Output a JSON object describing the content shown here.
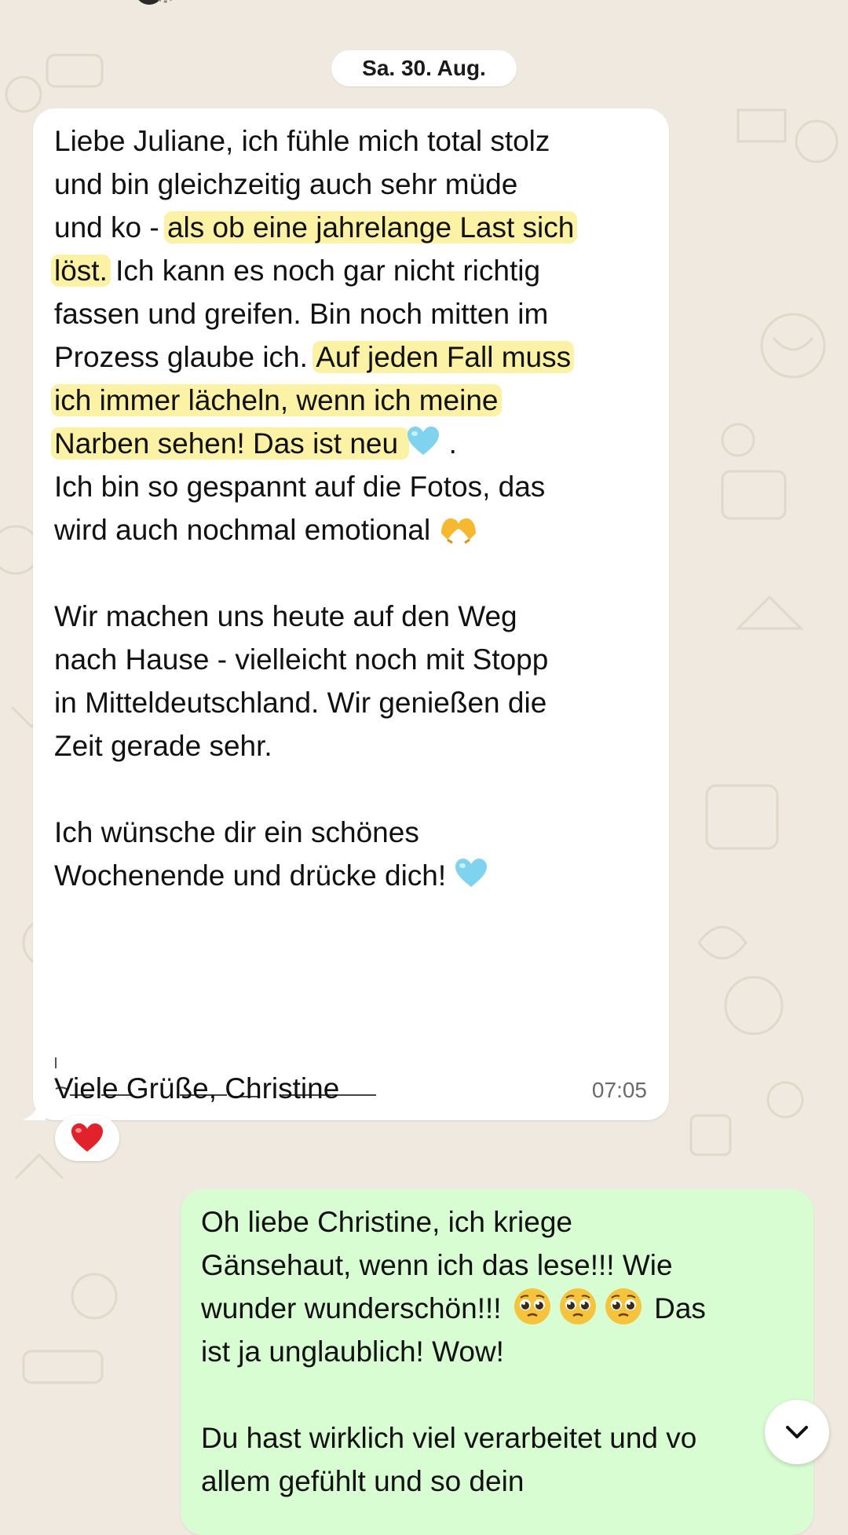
{
  "chat": {
    "date_separator": "Sa. 30. Aug.",
    "incoming_message": {
      "lines": [
        {
          "parts": [
            {
              "text": "Liebe Juliane, ich fühle mich total stolz"
            }
          ]
        },
        {
          "parts": [
            {
              "text": "und bin gleichzeitig auch sehr müde"
            }
          ]
        },
        {
          "parts": [
            {
              "text": "und ko - "
            },
            {
              "text": "als ob eine jahrelange Last sich",
              "highlight": true
            }
          ]
        },
        {
          "parts": [
            {
              "text": "löst.",
              "highlight": true
            },
            {
              "text": " Ich kann es noch gar nicht richtig"
            }
          ]
        },
        {
          "parts": [
            {
              "text": "fassen und greifen. Bin noch mitten im"
            }
          ]
        },
        {
          "parts": [
            {
              "text": "Prozess glaube ich. "
            },
            {
              "text": "Auf jeden Fall muss",
              "highlight": true
            }
          ]
        },
        {
          "parts": [
            {
              "text": "ich immer lächeln, wenn ich meine",
              "highlight": true
            }
          ]
        },
        {
          "parts": [
            {
              "text": "Narben sehen! Das ist neu ",
              "highlight": true
            },
            {
              "emoji": "blue-heart"
            },
            {
              "text": " ."
            }
          ]
        },
        {
          "parts": [
            {
              "text": "Ich bin so gespannt auf die Fotos, das"
            }
          ]
        },
        {
          "parts": [
            {
              "text": "wird auch nochmal emotional "
            },
            {
              "emoji": "heart-hands"
            }
          ]
        },
        {
          "parts": [
            {
              "text": ""
            }
          ]
        },
        {
          "parts": [
            {
              "text": "Wir machen uns heute auf den Weg"
            }
          ]
        },
        {
          "parts": [
            {
              "text": "nach Hause - vielleicht noch mit Stopp"
            }
          ]
        },
        {
          "parts": [
            {
              "text": "in Mitteldeutschland. Wir genießen die"
            }
          ]
        },
        {
          "parts": [
            {
              "text": "Zeit gerade sehr."
            }
          ]
        },
        {
          "parts": [
            {
              "text": ""
            }
          ]
        },
        {
          "parts": [
            {
              "text": "Ich wünsche dir ein schönes"
            }
          ]
        },
        {
          "parts": [
            {
              "text": "Wochenende und drücke dich! "
            },
            {
              "emoji": "blue-heart"
            }
          ]
        }
      ],
      "signoff": "Viele Grüße, Christine",
      "time": "07:05",
      "reaction": "heart-emoji"
    },
    "outgoing_message": {
      "lines": [
        {
          "parts": [
            {
              "text": "Oh liebe Christine, ich kriege"
            }
          ]
        },
        {
          "parts": [
            {
              "text": "Gänsehaut, wenn ich das lese!!! Wie"
            }
          ]
        },
        {
          "parts": [
            {
              "text": "wunder wunderschön!!! "
            },
            {
              "emoji": "pleading-face"
            },
            {
              "emoji": "pleading-face"
            },
            {
              "emoji": "pleading-face"
            },
            {
              "text": " Das"
            }
          ]
        },
        {
          "parts": [
            {
              "text": "ist ja unglaublich! Wow!"
            }
          ]
        },
        {
          "parts": [
            {
              "text": ""
            }
          ]
        },
        {
          "parts": [
            {
              "text": "Du hast wirklich viel verarbeitet und vo"
            }
          ]
        },
        {
          "parts": [
            {
              "text": "allem gefühlt und so dein"
            }
          ]
        }
      ]
    },
    "scroll_button_icon": "chevron-down-icon"
  },
  "colors": {
    "background": "#efe9df",
    "incoming_bubble": "#ffffff",
    "outgoing_bubble": "#d9fdd3",
    "highlight": "#fbf2a6",
    "timestamp": "#6a6a6a"
  }
}
